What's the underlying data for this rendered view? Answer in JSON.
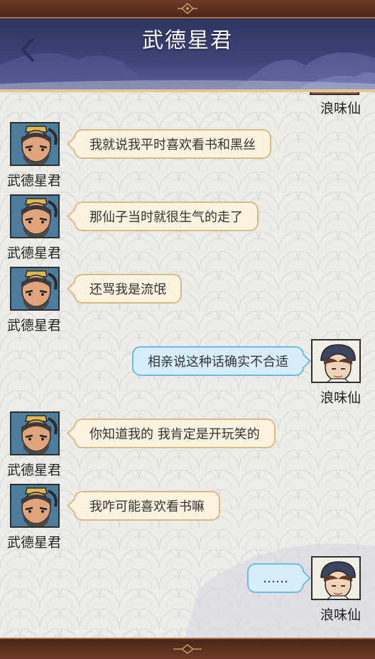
{
  "header": {
    "title": "武德星君",
    "back_icon": "chevron-left-icon"
  },
  "colors": {
    "header_bg": "#3e4478",
    "npc_bubble": "#fbf3df",
    "player_bubble": "#d7eefa",
    "frame": "#5a2e20"
  },
  "chat": {
    "clipped_top_name": "浪味仙",
    "messages": [
      {
        "sender": "武德星君",
        "side": "left",
        "text": "我就说我平时喜欢看书和黑丝"
      },
      {
        "sender": "武德星君",
        "side": "left",
        "text": "那仙子当时就很生气的走了"
      },
      {
        "sender": "武德星君",
        "side": "left",
        "text": "还骂我是流氓"
      },
      {
        "sender": "浪味仙",
        "side": "right",
        "text": "相亲说这种话确实不合适"
      },
      {
        "sender": "武德星君",
        "side": "left",
        "text": "你知道我的 我肯定是开玩笑的"
      },
      {
        "sender": "武德星君",
        "side": "left",
        "text": "我咋可能喜欢看书嘛"
      },
      {
        "sender": "浪味仙",
        "side": "right",
        "text": "……"
      }
    ]
  }
}
